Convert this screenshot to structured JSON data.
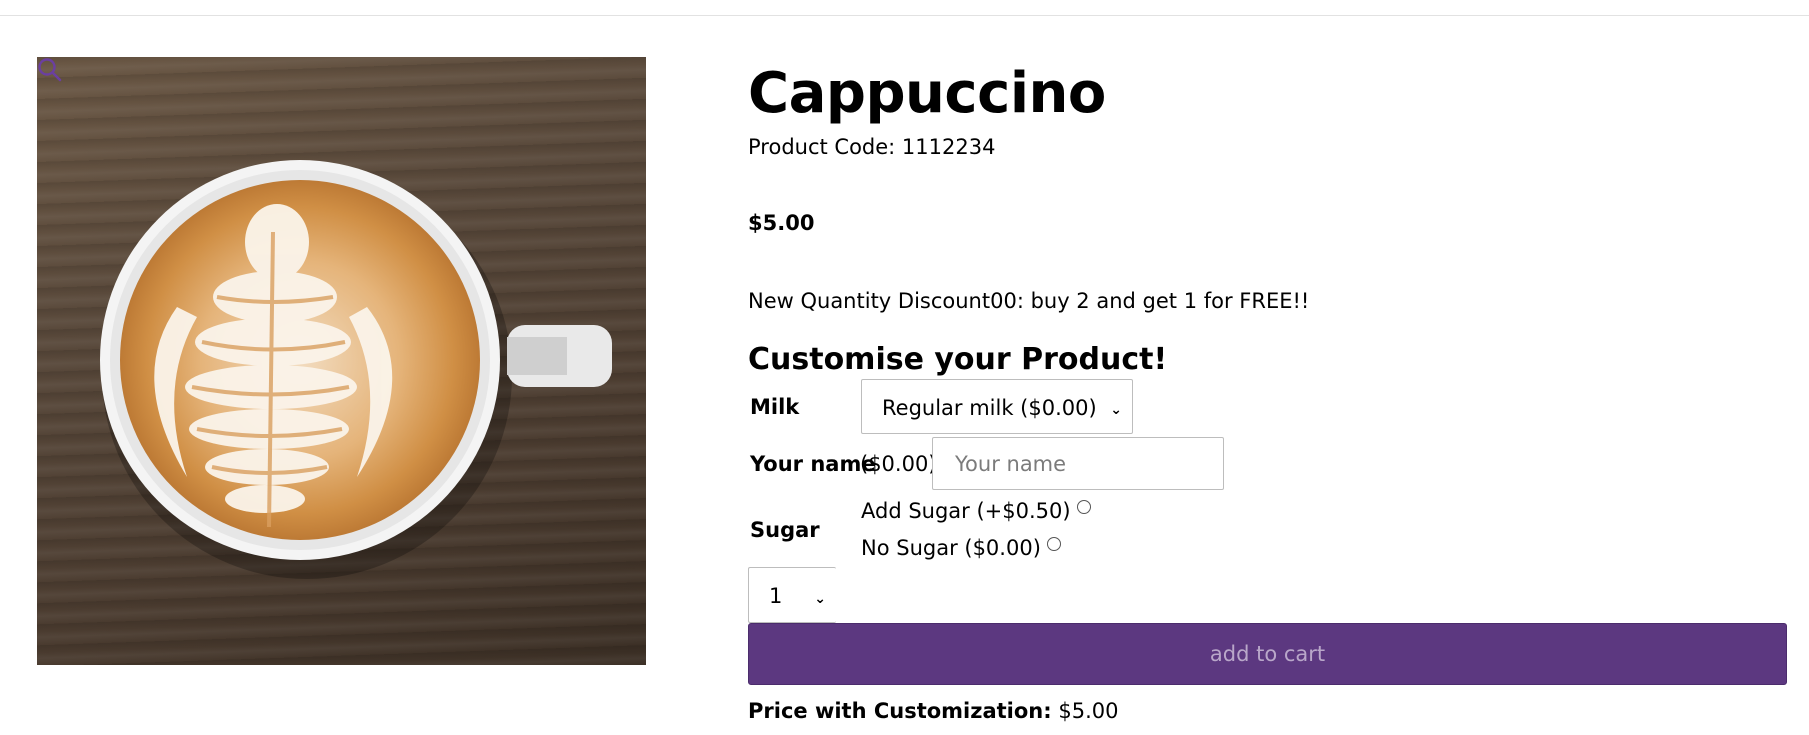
{
  "product": {
    "title": "Cappuccino",
    "code": "Product Code: 1112234",
    "price": "$5.00",
    "promo": "New Quantity Discount00: buy 2 and get 1 for FREE!!",
    "image_icon": "zoom-icon"
  },
  "customise": {
    "heading": "Customise your Product!",
    "milk_label": "Milk",
    "milk_selected": "Regular milk ($0.00)",
    "name_label": "Your name",
    "name_price": "($0.00)",
    "name_placeholder": "Your name",
    "name_value": "",
    "sugar_label": "Sugar",
    "sugar_options": [
      "Add Sugar (+$0.50)",
      "No Sugar ($0.00)"
    ]
  },
  "cart": {
    "quantity": "1",
    "add_label": "add to cart",
    "total_label": "Price with Customization:",
    "total_value": "$5.00"
  },
  "colors": {
    "accent": "#5c3880",
    "button_text": "#b9a7c9"
  }
}
